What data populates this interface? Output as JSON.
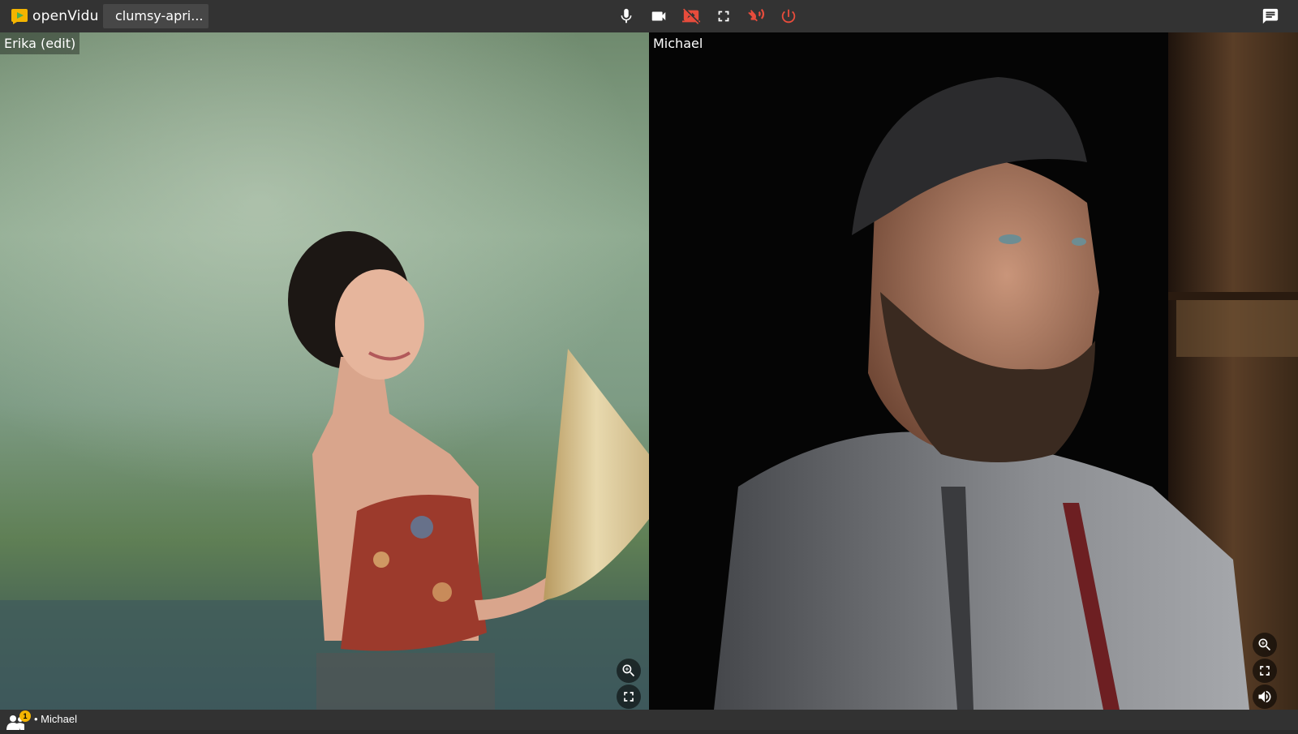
{
  "app": {
    "logo_text": "openVidu",
    "session_name": "clumsy-apri..."
  },
  "toolbar": {
    "buttons": [
      {
        "name": "mic",
        "icon": "microphone-icon",
        "state": "on"
      },
      {
        "name": "camera",
        "icon": "videocam-icon",
        "state": "on"
      },
      {
        "name": "screen-share",
        "icon": "stop-screen-share-icon",
        "state": "off"
      },
      {
        "name": "fullscreen",
        "icon": "fullscreen-icon",
        "state": "on"
      },
      {
        "name": "voice-off",
        "icon": "voice-over-off-icon",
        "state": "off"
      },
      {
        "name": "leave",
        "icon": "power-icon",
        "state": "off"
      }
    ],
    "chat_icon": "chat-icon"
  },
  "participants": [
    {
      "name": "Erika (edit)",
      "video": "woman-in-water-with-hat"
    },
    {
      "name": "Michael",
      "video": "bearded-man-in-hoodie"
    }
  ],
  "footer": {
    "badge_count": "1",
    "text": "• Michael"
  },
  "colors": {
    "toolbar_bg": "#333333",
    "icon_white": "#ffffff",
    "icon_red": "#e74c3c",
    "badge": "#f4b400"
  }
}
